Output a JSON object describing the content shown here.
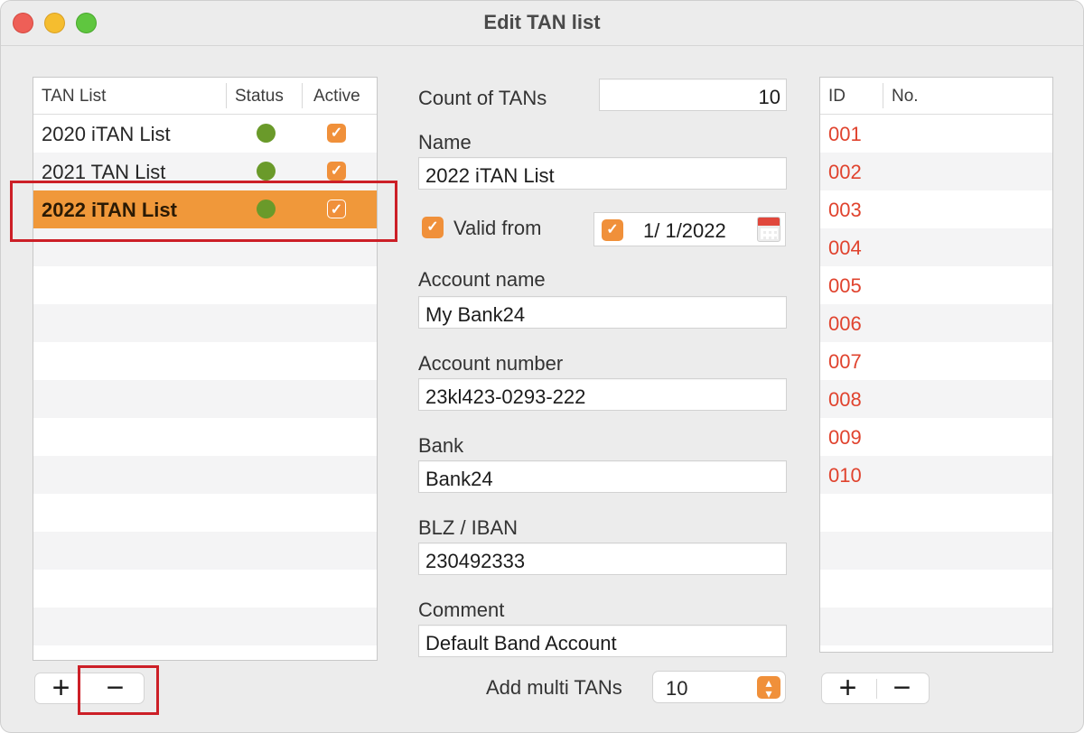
{
  "window": {
    "title": "Edit TAN list"
  },
  "tan_table": {
    "headers": [
      "TAN List",
      "Status",
      "Active"
    ],
    "rows": [
      {
        "name": "2020 iTAN List",
        "active": true
      },
      {
        "name": "2021 TAN List",
        "active": true
      },
      {
        "name": "2022 iTAN List",
        "active": true,
        "selected": true
      }
    ],
    "add_label": "+",
    "remove_label": "−"
  },
  "form": {
    "count_label": "Count of TANs",
    "count_value": "10",
    "name_label": "Name",
    "name_value": "2022 iTAN List",
    "valid_from_label": "Valid from",
    "valid_from_date": "1/  1/2022",
    "account_name_label": "Account name",
    "account_name_value": "My Bank24",
    "account_number_label": "Account number",
    "account_number_value": "23kl423-0293-222",
    "bank_label": "Bank",
    "bank_value": "Bank24",
    "blz_label": "BLZ / IBAN",
    "blz_value": "230492333",
    "comment_label": "Comment",
    "comment_value": "Default Band Account",
    "add_multi_label": "Add multi TANs",
    "add_multi_value": "10"
  },
  "tan_numbers": {
    "headers": [
      "ID",
      "No."
    ],
    "ids": [
      "001",
      "002",
      "003",
      "004",
      "005",
      "006",
      "007",
      "008",
      "009",
      "010"
    ],
    "add_label": "+",
    "remove_label": "−"
  },
  "colors": {
    "accent": "#f0983a",
    "status_green": "#6a9a2a",
    "id_red": "#e0432e",
    "highlight": "#cc1f27"
  }
}
